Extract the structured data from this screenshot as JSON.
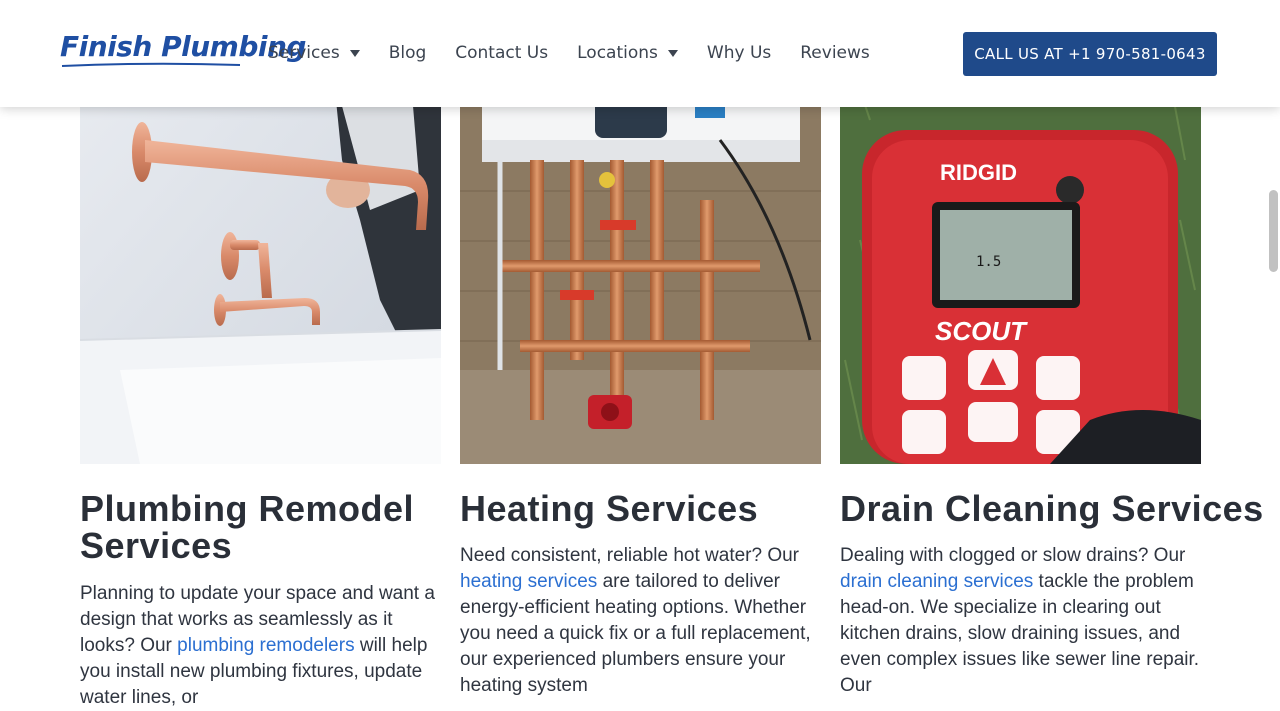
{
  "header": {
    "logo": "Finish Plumbing",
    "nav": [
      {
        "label": "Services",
        "dropdown": true
      },
      {
        "label": "Blog",
        "dropdown": false
      },
      {
        "label": "Contact Us",
        "dropdown": false
      },
      {
        "label": "Locations",
        "dropdown": true
      },
      {
        "label": "Why Us",
        "dropdown": false
      },
      {
        "label": "Reviews",
        "dropdown": false
      }
    ],
    "cta_label": "CALL US AT +1 970-581-0643"
  },
  "cards": [
    {
      "title_line1": "Plumbing Remodel",
      "title_line2": "Services",
      "text_before": "Planning to update your space and want a design that works as seamlessly as it looks? Our",
      "link": "plumbing remodelers",
      "text_after": "will help you install new plumbing fixtures, update water lines, or"
    },
    {
      "title_line1": "Heating Services",
      "title_line2": "",
      "text_before": "Need consistent, reliable hot water? Our",
      "link": "heating services",
      "text_after": "are tailored to deliver energy-efficient heating options. Whether you need a quick fix or a full replacement, our experienced plumbers ensure your heating system"
    },
    {
      "title_line1": "Drain Cleaning Services",
      "title_line2": "",
      "text_before": "Dealing with clogged or slow drains? Our",
      "link": "drain cleaning services",
      "text_after": "tackle the problem head-on. We specialize in clearing out kitchen drains, slow draining issues, and even complex issues like sewer line repair. Our"
    }
  ],
  "device_screen": {
    "brand": "RIDGID",
    "model": "SCOUT",
    "reading": "1.5"
  },
  "colors": {
    "brand": "#1f4fa3",
    "cta": "#1f4a8a",
    "link": "#2b6fd1",
    "heading": "#2a2f38"
  }
}
